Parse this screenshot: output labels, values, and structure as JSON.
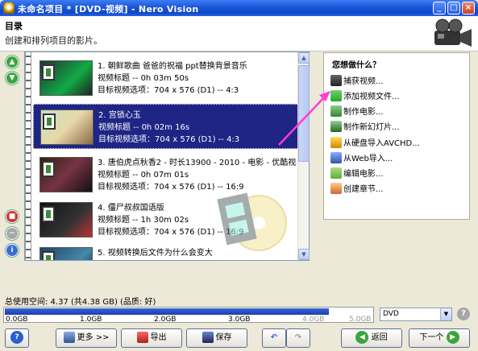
{
  "window": {
    "title": "未命名项目 * [DVD-视频] - Nero Vision"
  },
  "header": {
    "title": "目录",
    "subtitle": "创建和排列项目的影片。"
  },
  "items": [
    {
      "number": "1.",
      "title": "朝鲜歌曲 爸爸的祝福 ppt替换背景音乐",
      "track": "视频标题 -- 0h 03m 50s",
      "target": "目标视频选项：704 x 576 (D1) -- 4:3"
    },
    {
      "number": "2.",
      "title": "宫锁心玉",
      "track": "视频标题 -- 0h 02m 16s",
      "target": "目标视频选项：704 x 576 (D1) -- 4:3"
    },
    {
      "number": "3.",
      "title": "唐伯虎点秋香2 - 时长13900 - 2010 - 电影 - 优酷视",
      "track": "视频标题 -- 0h 07m 01s",
      "target": "目标视频选项：704 x 576 (D1) -- 16:9"
    },
    {
      "number": "4.",
      "title": "僵尸叔叔国语版",
      "track": "视频标题 -- 1h 30m 02s",
      "target": "目标视频选项：704 x 576 (D1) -- 16:9"
    },
    {
      "number": "5.",
      "title": "视频转换后文件为什么会变大",
      "track": "",
      "target": ""
    }
  ],
  "actions": {
    "title": "您想做什么？",
    "items": [
      {
        "label": "捕获视频...",
        "icon": "camera-icon"
      },
      {
        "label": "添加视频文件...",
        "icon": "add-video-icon"
      },
      {
        "label": "制作电影...",
        "icon": "make-movie-icon"
      },
      {
        "label": "制作新幻灯片...",
        "icon": "slideshow-icon"
      },
      {
        "label": "从硬盘导入AVCHD...",
        "icon": "avchd-icon"
      },
      {
        "label": "从Web导入...",
        "icon": "web-import-icon"
      },
      {
        "label": "编辑电影...",
        "icon": "edit-movie-icon"
      },
      {
        "label": "创建章节...",
        "icon": "chapter-icon"
      }
    ]
  },
  "usage": {
    "label": "总使用空间: 4.37 (共4.38 GB) (品质: 好)",
    "used_fraction": 0.994,
    "ticks": [
      "0.0GB",
      "1.0GB",
      "2.0GB",
      "3.0GB",
      "4.0GB",
      "5.0GB"
    ],
    "disc_type": "DVD"
  },
  "bottom": {
    "more": "更多 >>",
    "export": "导出",
    "save": "保存",
    "back": "返回",
    "next": "下一个"
  },
  "colors": {
    "selection": "#1e2585",
    "usage_bar": "#2a4fc0",
    "arrow": "#ff3cd0"
  }
}
